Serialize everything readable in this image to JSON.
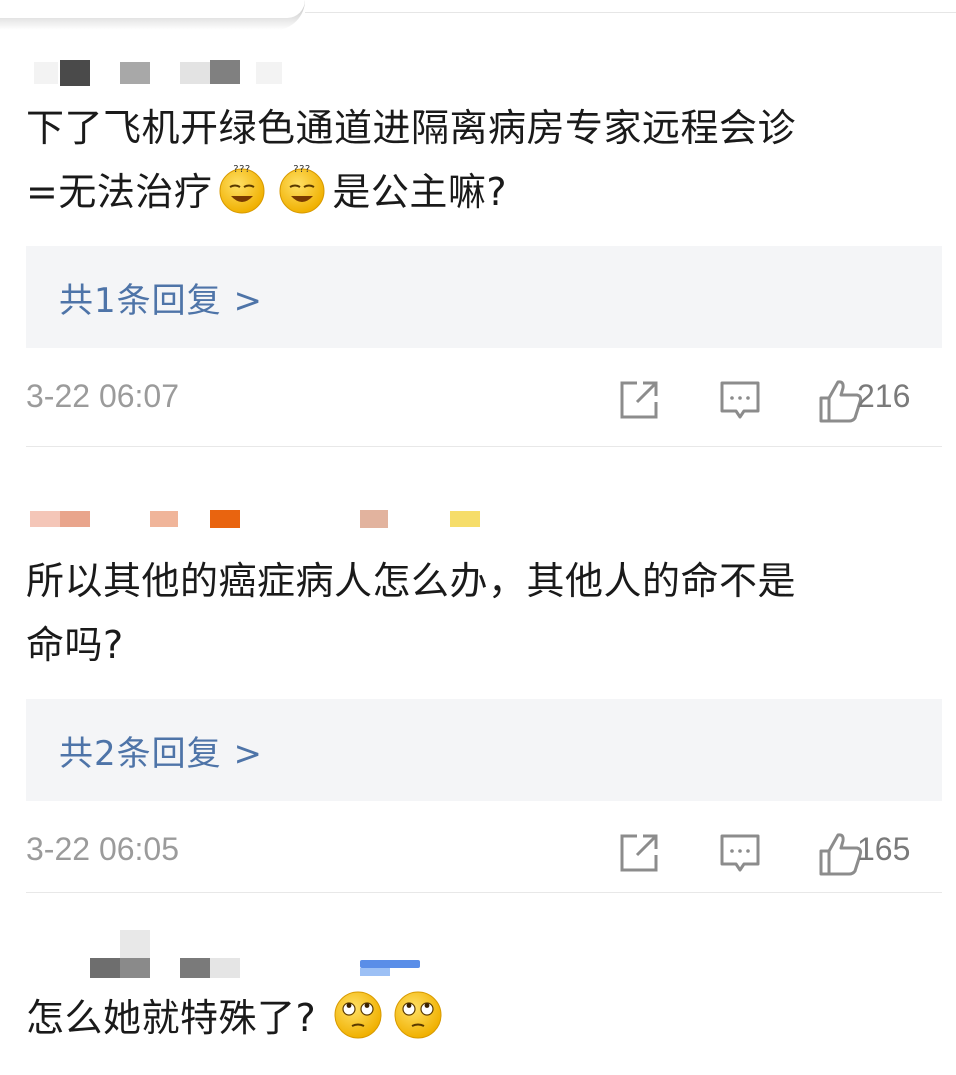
{
  "comments": [
    {
      "text_line1": "下了飞机开绿色通道进隔离病房专家远程会诊",
      "text_line2_prefix": "=无法治疗",
      "text_line2_suffix": "是公主嘛?",
      "emojis": [
        "dizzy-smile-emoji",
        "dizzy-smile-emoji"
      ],
      "reply_label": "共1条回复 >",
      "timestamp": "3-22 06:07",
      "like_count": "216"
    },
    {
      "text_line1": "所以其他的癌症病人怎么办，其他人的命不是",
      "text_line2": "命吗?",
      "reply_label": "共2条回复 >",
      "timestamp": "3-22 06:05",
      "like_count": "165"
    },
    {
      "text_prefix": "怎么她就特殊了?",
      "emojis": [
        "eye-roll-emoji",
        "eye-roll-emoji"
      ]
    }
  ],
  "icons": {
    "share": "share-icon",
    "comment": "comment-icon",
    "like": "thumbs-up-icon"
  },
  "colors": {
    "reply_link": "#4e74a8",
    "reply_bg": "#f4f5f7",
    "meta_text": "#9b9b9b",
    "emoji_yellow": "#f7c42c"
  }
}
